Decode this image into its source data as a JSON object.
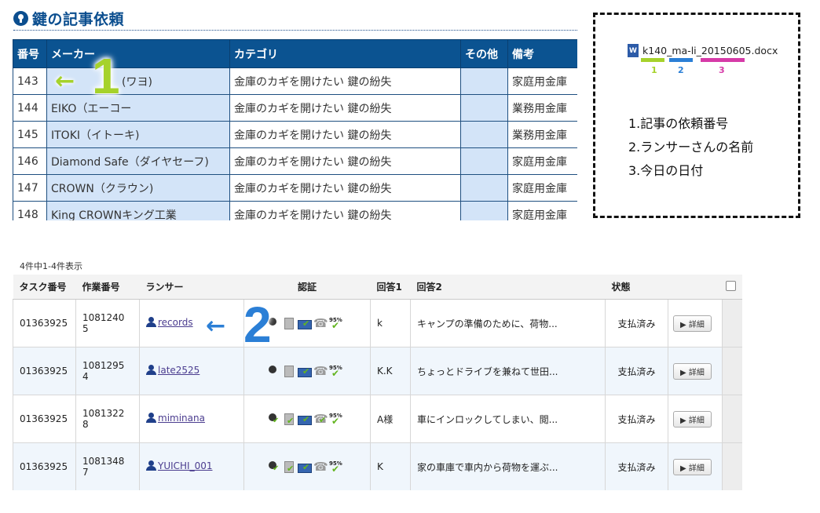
{
  "heading": {
    "title": "鍵の記事依頼"
  },
  "top_table": {
    "headers": [
      "番号",
      "メーカー",
      "カテゴリ",
      "その他",
      "備考"
    ],
    "rows": [
      [
        "143",
        "(ワヨ)",
        "金庫のカギを開けたい 鍵の紛失",
        "",
        "家庭用金庫"
      ],
      [
        "144",
        "EIKO（エーコー",
        "金庫のカギを開けたい 鍵の紛失",
        "",
        "業務用金庫"
      ],
      [
        "145",
        "ITOKI（イトーキ)",
        "金庫のカギを開けたい 鍵の紛失",
        "",
        "業務用金庫"
      ],
      [
        "146",
        "Diamond Safe（ダイヤセーフ)",
        "金庫のカギを開けたい 鍵の紛失",
        "",
        "家庭用金庫"
      ],
      [
        "147",
        "CROWN（クラウン)",
        "金庫のカギを開けたい 鍵の紛失",
        "",
        "家庭用金庫"
      ],
      [
        "148",
        "King CROWNキング工業",
        "金庫のカギを開けたい 鍵の紛失",
        "",
        "家庭用金庫"
      ]
    ]
  },
  "note": {
    "filename": "k140_ma-li_20150605.docx",
    "doc_icon_letter": "W",
    "bar_labels": [
      "1",
      "2",
      "3"
    ],
    "bar_colors": [
      "#a6d22b",
      "#2b7fd6",
      "#d63aa8"
    ],
    "items": [
      "1.記事の依頼番号",
      "2.ランサーさんの名前",
      "3.今日の日付"
    ]
  },
  "annotations": {
    "arrow": "←",
    "num1": "1",
    "num2": "2",
    "color1": "#a6d22b",
    "color2": "#2b7fd6"
  },
  "count_text": "4件中1-4件表示",
  "bottom_table": {
    "headers": [
      "タスク番号",
      "作業番号",
      "ランサー",
      "認証",
      "回答1",
      "回答2",
      "状態",
      "",
      ""
    ],
    "rows": [
      {
        "task": "01363925",
        "work_a": "1081240",
        "work_b": "5",
        "lancer": "records",
        "pct": "95%",
        "a1": "k",
        "a2": "キャンプの準備のために、荷物...",
        "status": "支払済み",
        "detail": "▶ 詳細"
      },
      {
        "task": "01363925",
        "work_a": "1081295",
        "work_b": "4",
        "lancer": "late2525",
        "pct": "95%",
        "a1": "K.K",
        "a2": "ちょっとドライブを兼ねて世田...",
        "status": "支払済み",
        "detail": "▶ 詳細"
      },
      {
        "task": "01363925",
        "work_a": "1081322",
        "work_b": "8",
        "lancer": "miminana",
        "pct": "95%",
        "a1": "A様",
        "a2": "車にインロックしてしまい、閲...",
        "status": "支払済み",
        "detail": "▶ 詳細"
      },
      {
        "task": "01363925",
        "work_a": "1081348",
        "work_b": "7",
        "lancer": "YUICHI_001",
        "pct": "95%",
        "a1": "K",
        "a2": "家の車庫で車内から荷物を運ぶ...",
        "status": "支払済み",
        "detail": "▶ 詳細"
      }
    ]
  }
}
